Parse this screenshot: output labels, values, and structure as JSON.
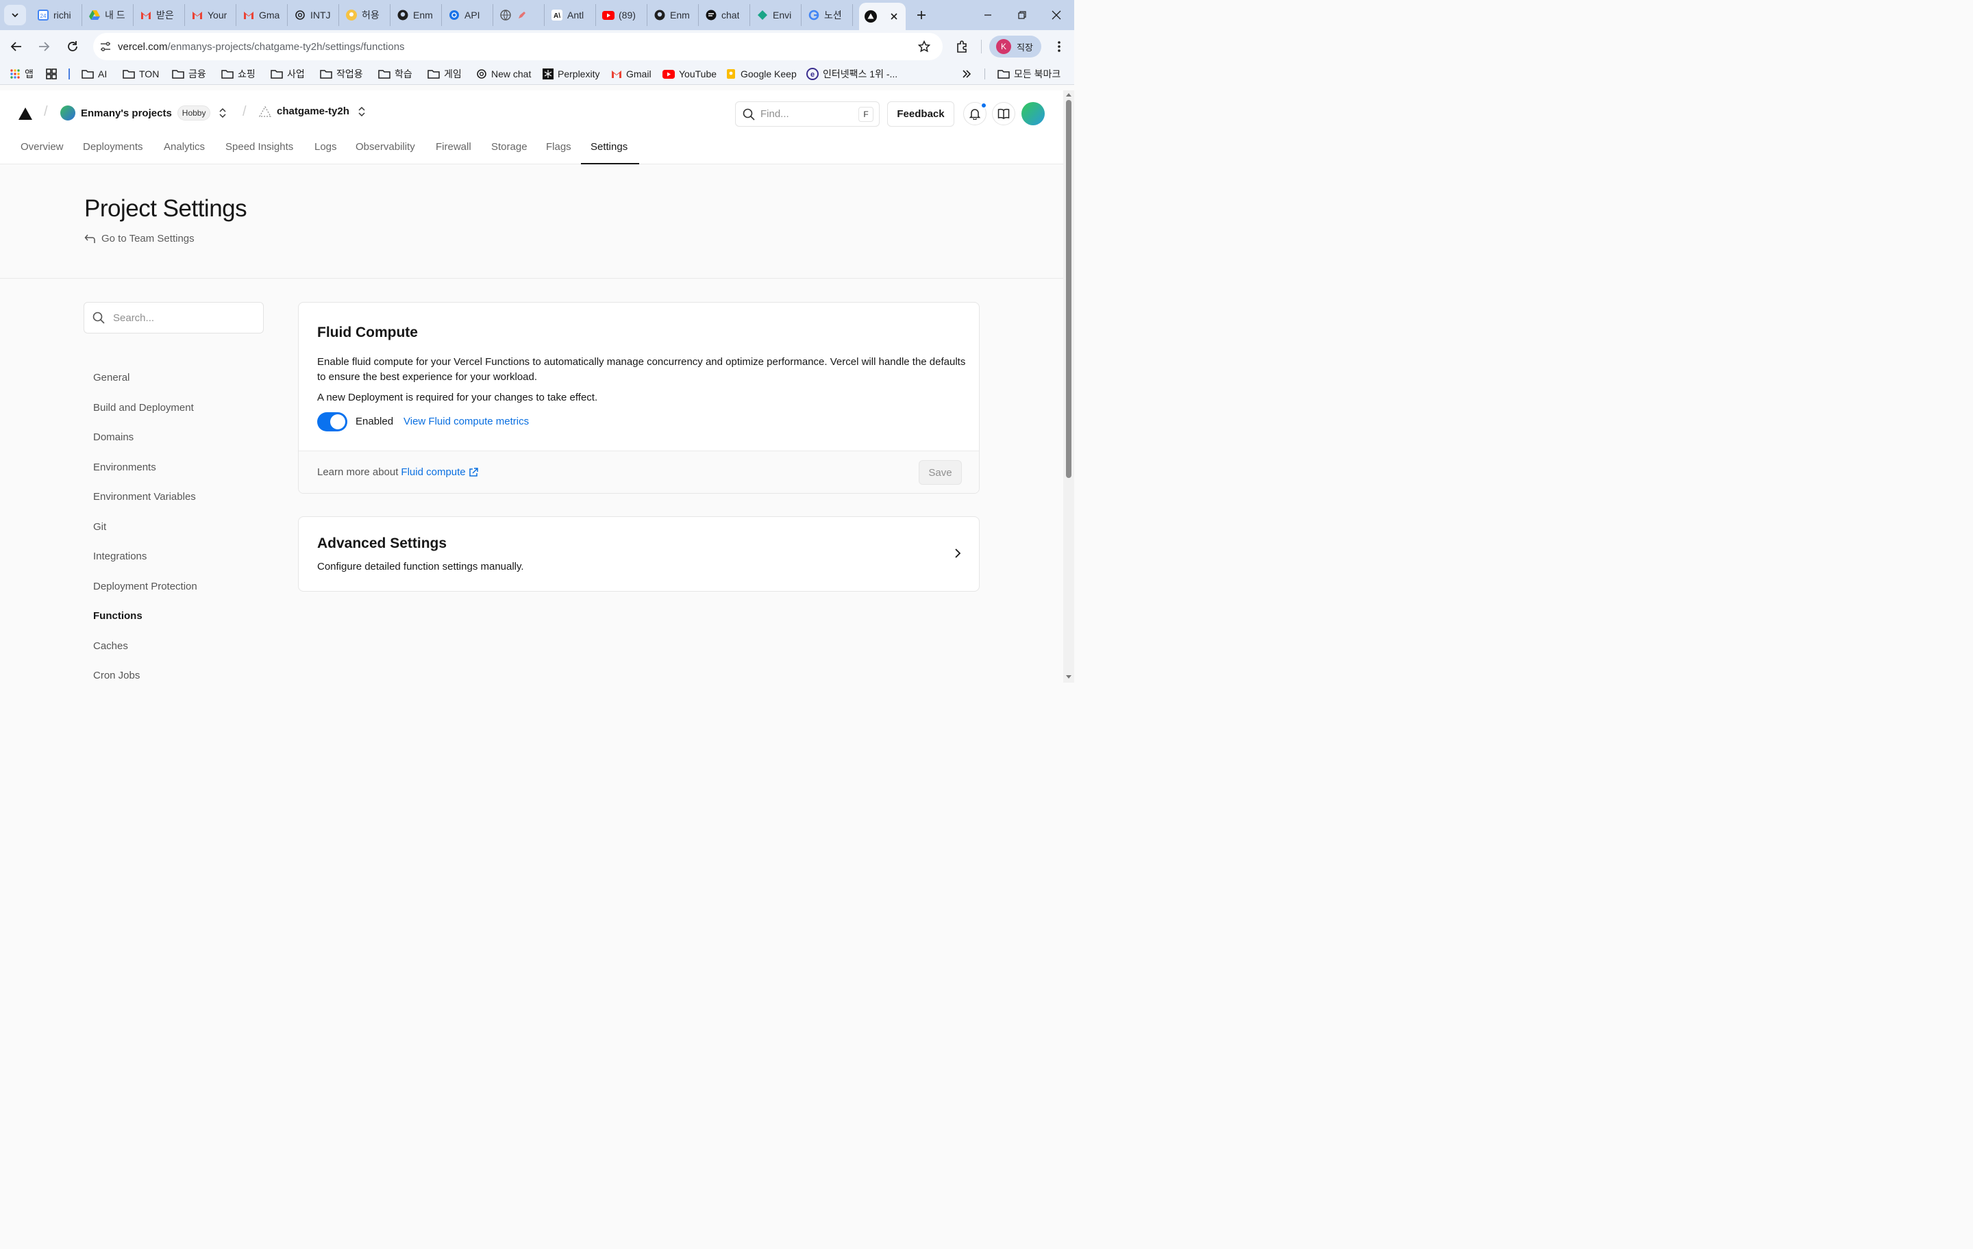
{
  "browser": {
    "tabs": [
      {
        "icon": "calendar-icon",
        "title": "richi"
      },
      {
        "icon": "google-drive-icon",
        "title": "내 드"
      },
      {
        "icon": "gmail-icon",
        "title": "받은"
      },
      {
        "icon": "gmail-icon",
        "title": "Your"
      },
      {
        "icon": "gmail-icon",
        "title": "Gma"
      },
      {
        "icon": "openai-icon",
        "title": "INTJ"
      },
      {
        "icon": "bulb-icon",
        "title": "허용"
      },
      {
        "icon": "github-icon",
        "title": "Enm"
      },
      {
        "icon": "openai-icon",
        "title": "API"
      },
      {
        "icon": "globe-icon",
        "title": ""
      },
      {
        "icon": "anthropic-icon",
        "title": "Antl"
      },
      {
        "icon": "youtube-icon",
        "title": "(89)"
      },
      {
        "icon": "github-icon",
        "title": "Enm"
      },
      {
        "icon": "chat-icon",
        "title": "chat"
      },
      {
        "icon": "diamond-icon",
        "title": "Envi"
      },
      {
        "icon": "google-icon",
        "title": "노션"
      }
    ],
    "url_host": "vercel.com",
    "url_path": "/enmanys-projects/chatgame-ty2h/settings/functions",
    "profile_initial": "K",
    "profile_label": "직장",
    "bookmarks": [
      {
        "icon": "apps-grid-icon",
        "label": "앱"
      },
      {
        "icon": "tab-groups-icon",
        "label": ""
      },
      {
        "icon": "folder-icon",
        "label": "AI"
      },
      {
        "icon": "folder-icon",
        "label": "TON"
      },
      {
        "icon": "folder-icon",
        "label": "금융"
      },
      {
        "icon": "folder-icon",
        "label": "쇼핑"
      },
      {
        "icon": "folder-icon",
        "label": "사업"
      },
      {
        "icon": "folder-icon",
        "label": "작업용"
      },
      {
        "icon": "folder-icon",
        "label": "학습"
      },
      {
        "icon": "folder-icon",
        "label": "게임"
      },
      {
        "icon": "openai-icon",
        "label": "New chat"
      },
      {
        "icon": "perplexity-icon",
        "label": "Perplexity"
      },
      {
        "icon": "gmail-icon",
        "label": "Gmail"
      },
      {
        "icon": "youtube-icon",
        "label": "YouTube"
      },
      {
        "icon": "keep-icon",
        "label": "Google Keep"
      },
      {
        "icon": "e-icon",
        "label": "인터넷팩스 1위 -..."
      }
    ],
    "all_bookmarks": "모든 북마크"
  },
  "header": {
    "team": "Enmany's projects",
    "plan": "Hobby",
    "project": "chatgame-ty2h",
    "find_placeholder": "Find...",
    "find_shortcut": "F",
    "feedback": "Feedback",
    "nav": [
      "Overview",
      "Deployments",
      "Analytics",
      "Speed Insights",
      "Logs",
      "Observability",
      "Firewall",
      "Storage",
      "Flags",
      "Settings"
    ],
    "active_nav": "Settings"
  },
  "page": {
    "title": "Project Settings",
    "back_link": "Go to Team Settings"
  },
  "sidebar": {
    "search_placeholder": "Search...",
    "items": [
      "General",
      "Build and Deployment",
      "Domains",
      "Environments",
      "Environment Variables",
      "Git",
      "Integrations",
      "Deployment Protection",
      "Functions",
      "Caches",
      "Cron Jobs"
    ],
    "active": "Functions"
  },
  "fluid": {
    "title": "Fluid Compute",
    "description": "Enable fluid compute for your Vercel Functions to automatically manage concurrency and optimize performance. Vercel will handle the defaults to ensure the best experience for your workload.",
    "note": "A new Deployment is required for your changes to take effect.",
    "enabled": true,
    "toggle_label": "Enabled",
    "metrics_link": "View Fluid compute metrics",
    "learn_prefix": "Learn more about",
    "learn_link": "Fluid compute",
    "save": "Save"
  },
  "advanced": {
    "title": "Advanced Settings",
    "description": "Configure detailed function settings manually."
  },
  "colors": {
    "accent": "#0a72ef",
    "link": "#0a6fe0",
    "tabbar": "#c6d5ec"
  }
}
